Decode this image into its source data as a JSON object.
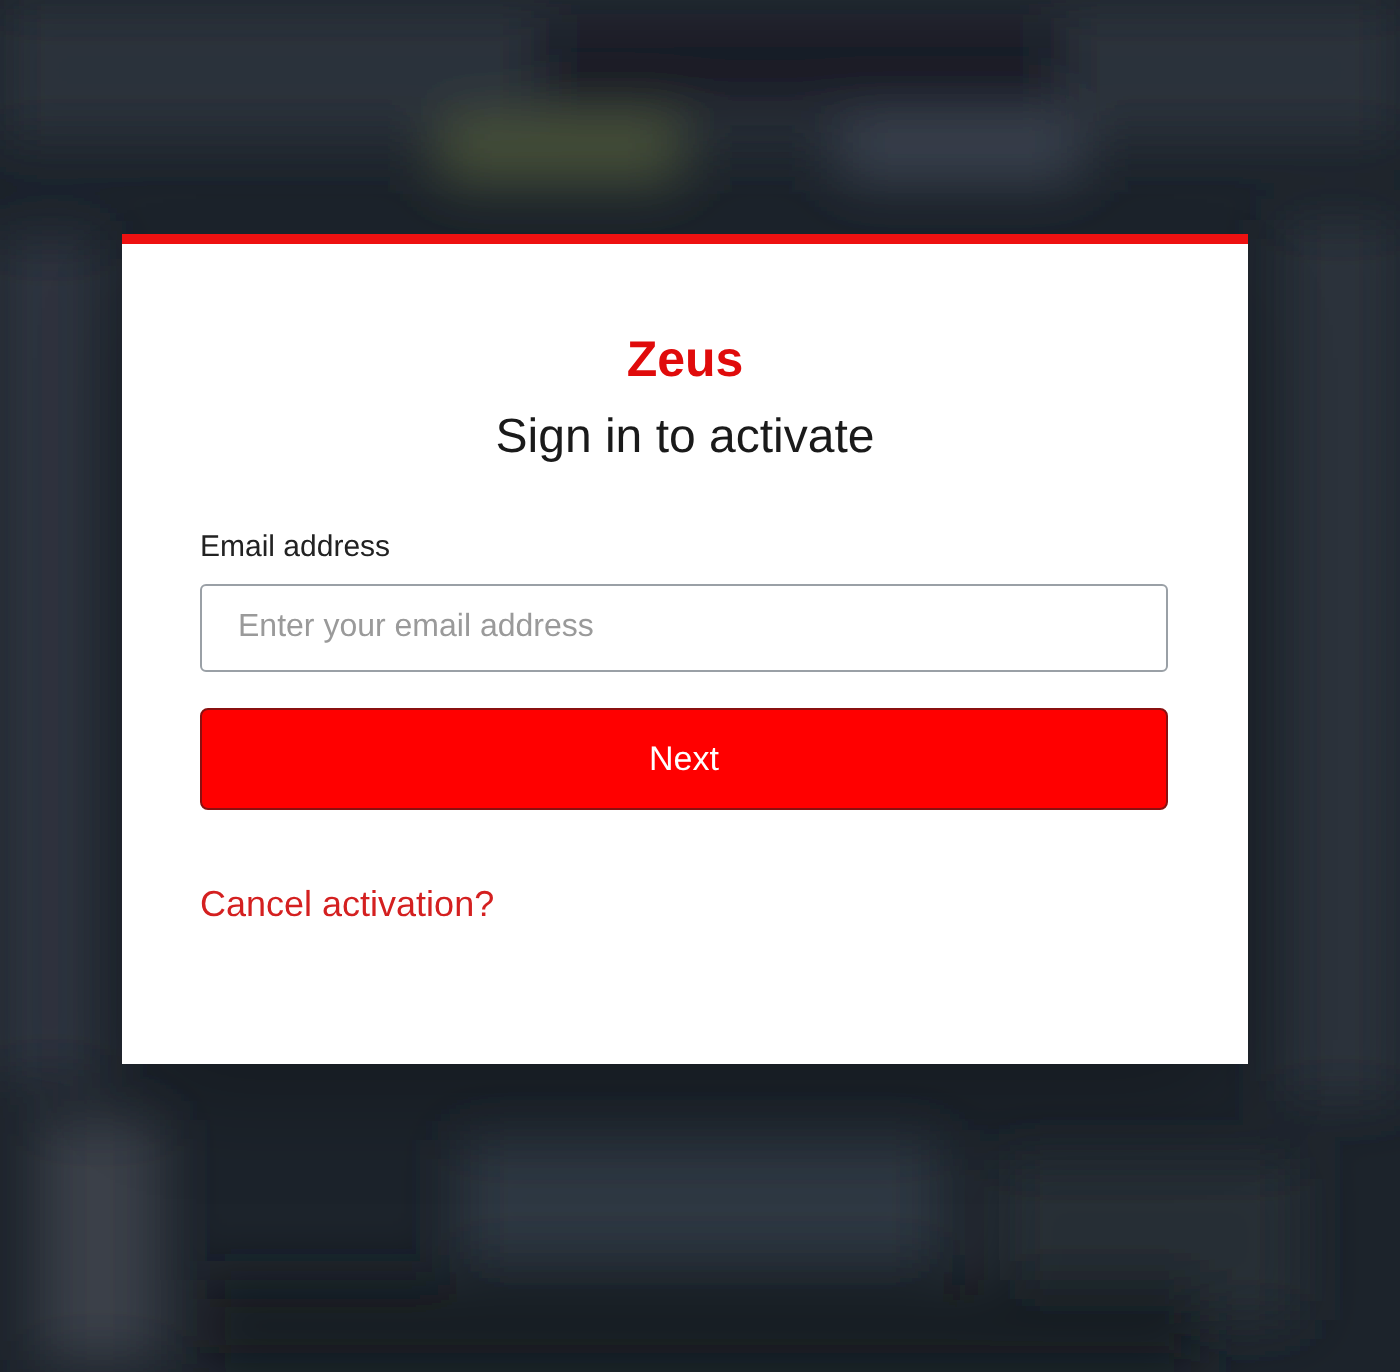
{
  "dialog": {
    "brand": "Zeus",
    "title": "Sign in to activate",
    "email_field": {
      "label": "Email address",
      "placeholder": "Enter your email address"
    },
    "next_button": "Next",
    "cancel_link": "Cancel activation?"
  }
}
